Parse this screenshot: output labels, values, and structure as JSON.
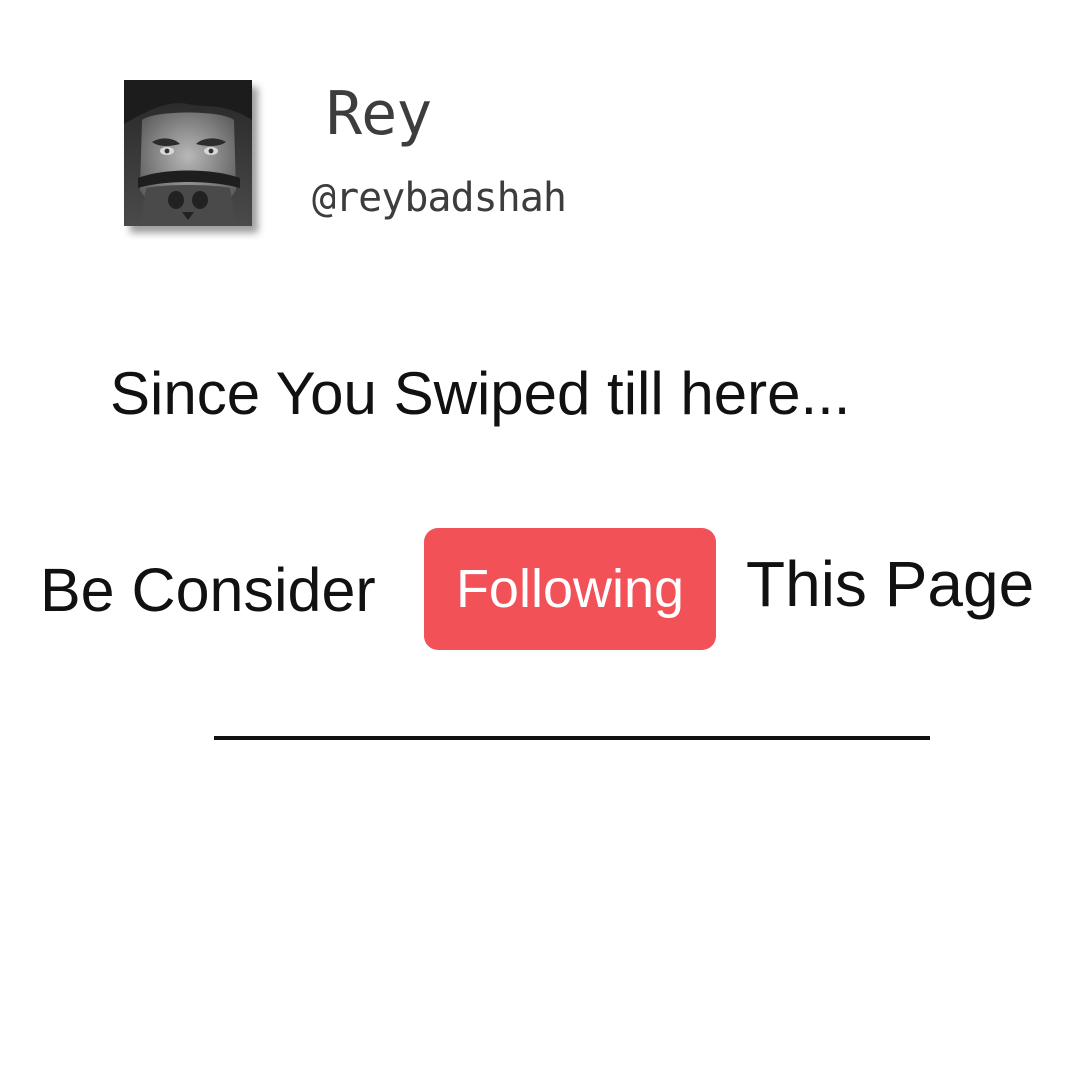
{
  "profile": {
    "name": "Rey",
    "handle": "@reybadshah"
  },
  "message": {
    "headline": "Since You Swiped till here...",
    "cta_prefix": "Be Consider",
    "follow_label": "Following",
    "cta_suffix": "This Page"
  },
  "colors": {
    "follow_button": "#f25157",
    "text": "#111111",
    "profile_text": "#3d3d3d",
    "background": "#ffffff"
  },
  "icons": {
    "avatar": "masked-face-avatar"
  }
}
